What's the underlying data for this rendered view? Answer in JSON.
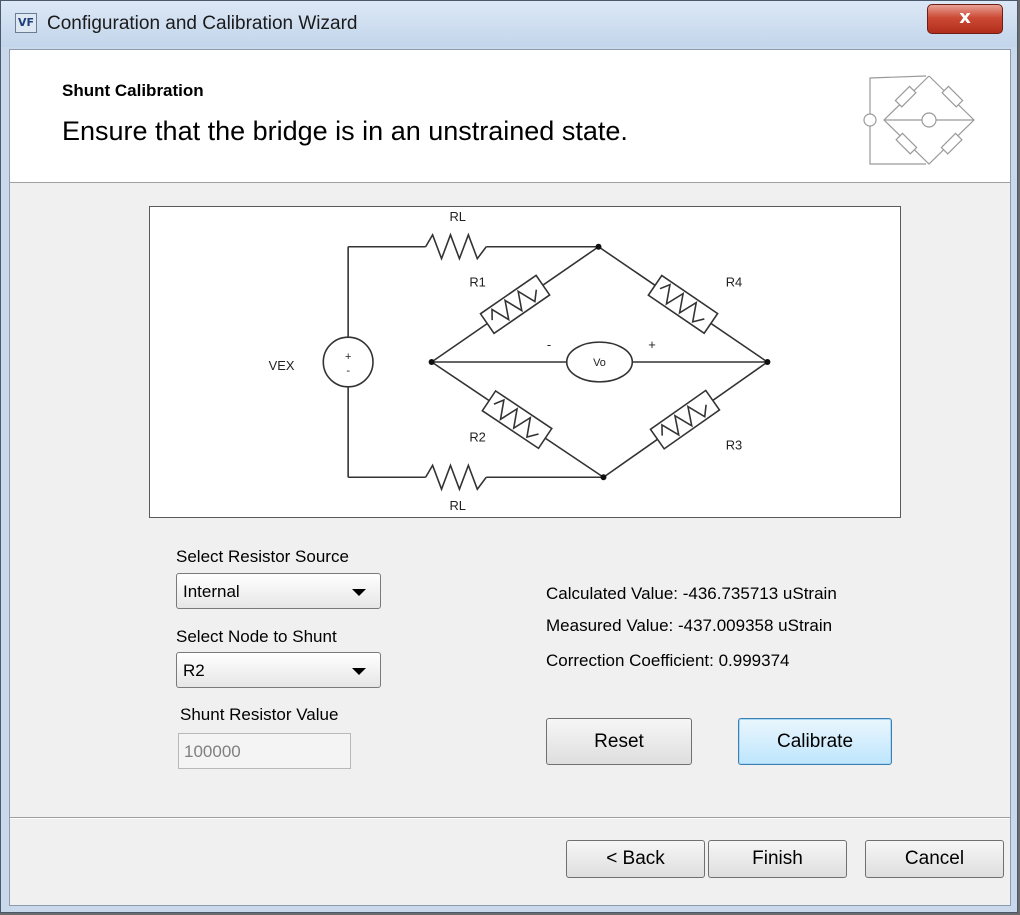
{
  "window": {
    "title": "Configuration and Calibration Wizard",
    "app_icon_text": "VF",
    "close_glyph": "x"
  },
  "header": {
    "title": "Shunt Calibration",
    "description": "Ensure that the bridge is in an unstrained state."
  },
  "diagram": {
    "labels": {
      "rl_top": "RL",
      "rl_bottom": "RL",
      "r1": "R1",
      "r2": "R2",
      "r3": "R3",
      "r4": "R4",
      "vex": "VEX",
      "vo": "Vo",
      "minus": "-",
      "plus": "+",
      "src_plus": "+",
      "src_minus": "-"
    }
  },
  "resistor_source": {
    "label": "Select Resistor Source",
    "value": "Internal"
  },
  "node_to_shunt": {
    "label": "Select Node to Shunt",
    "value": "R2"
  },
  "shunt_resistor": {
    "label": "Shunt Resistor Value",
    "value": "100000"
  },
  "results": {
    "calculated": "Calculated Value: -436.735713 uStrain",
    "measured": "Measured Value: -437.009358 uStrain",
    "correction": "Correction Coefficient: 0.999374"
  },
  "buttons": {
    "reset": "Reset",
    "calibrate": "Calibrate",
    "back": "< Back",
    "finish": "Finish",
    "cancel": "Cancel"
  }
}
